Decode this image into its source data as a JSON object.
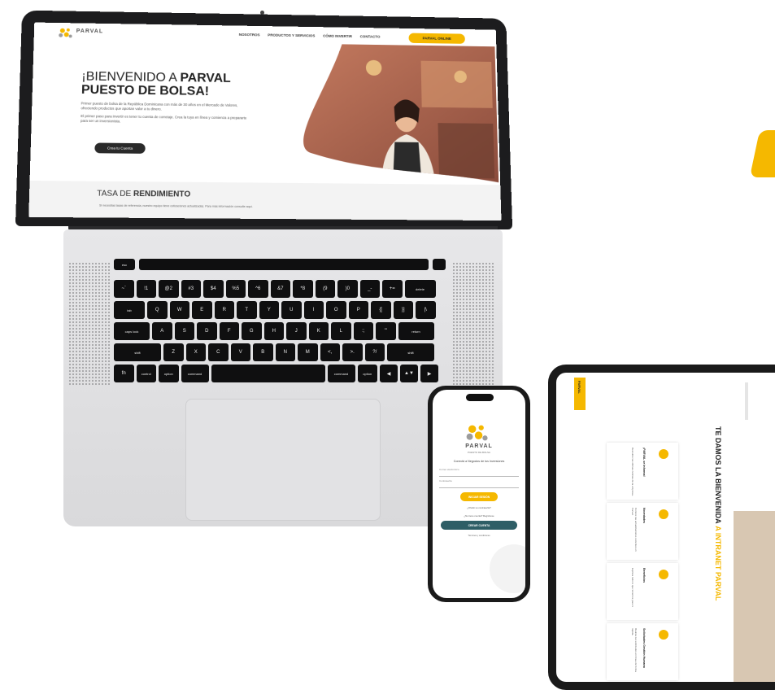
{
  "laptop": {
    "site": {
      "logo": "PARVAL",
      "nav": [
        "NOSOTROS",
        "PRODUCTOS Y SERVICIOS",
        "CÓMO INVERTIR",
        "CONTACTO"
      ],
      "nav_cta": "PARVAL ONLINE",
      "hero_title_1": "¡BIENVENIDO A ",
      "hero_title_bold_1": "PARVAL",
      "hero_title_bold_2": "PUESTO DE BOLSA!",
      "hero_p1": "Primer puesto de bolsa de la República Dominicana con más de 30 años en el Mercado de Valores, ofreciendo productos que aportan valor a tu dinero.",
      "hero_p2": "El primer paso para invertir es tener tu cuenta de corretaje. Crea la tuya en línea y comienza a prepararte para ser un inversionista.",
      "hero_cta": "Crea tu Cuenta",
      "tasa_light": "TASA DE ",
      "tasa_bold": "RENDIMIENTO",
      "tasa_note": "Si necesitas tasas de referencia, nuestro equipo tiene cotizaciones actualizadas. Para más información consulte aquí."
    },
    "keyboard_rows": [
      [
        "esc"
      ],
      [
        "~`",
        "!1",
        "@2",
        "#3",
        "$4",
        "%5",
        "^6",
        "&7",
        "*8",
        "(9",
        ")0",
        "_-",
        "+=",
        "delete"
      ],
      [
        "tab",
        "Q",
        "W",
        "E",
        "R",
        "T",
        "Y",
        "U",
        "I",
        "O",
        "P",
        "{[",
        "}]",
        "|\\"
      ],
      [
        "caps lock",
        "A",
        "S",
        "D",
        "F",
        "G",
        "H",
        "J",
        "K",
        "L",
        ":;",
        "\"'",
        "return"
      ],
      [
        "shift",
        "Z",
        "X",
        "C",
        "V",
        "B",
        "N",
        "M",
        "<,",
        ">.",
        "?/",
        "shift"
      ],
      [
        "fn",
        "control",
        "option",
        "command",
        "",
        "command",
        "option",
        "◀",
        "▲▼",
        "▶"
      ]
    ]
  },
  "phone": {
    "logo": "PARVAL",
    "logo_sub": "PUESTO DE BOLSA",
    "subtitle": "Conectá a Negocios de tus Inversiones",
    "field1": "Correo electrónico",
    "field2": "Contraseña",
    "primary_btn": "INICIAR SESIÓN",
    "link1": "¿Olvidó su contraseña?",
    "link2": "¿No tiene cuenta? Regístrese",
    "secondary_btn": "CREAR CUENTA",
    "footer": "Términos y condiciones"
  },
  "tablet": {
    "side_label": "PARVAL",
    "heading_1": "TE DAMOS LA BIENVENIDA",
    "heading_2": "A INTRANET PARVAL",
    "cards": [
      {
        "title": "¡PARVAL se informa!",
        "text": "Descubre las últimas noticias de la empresa."
      },
      {
        "title": "Novedades",
        "text": "Conoce las actualizaciones recientes en Parval."
      },
      {
        "title": "Beneficios",
        "text": "Explora todo lo que tenemos para ti."
      },
      {
        "title": "Solicitudes Gestión Humana",
        "text": "Realiza tus solicitudes en línea de forma rápida."
      }
    ]
  },
  "colors": {
    "brand_yellow": "#F5B800",
    "dark": "#222222",
    "teal": "#2E5E66"
  }
}
